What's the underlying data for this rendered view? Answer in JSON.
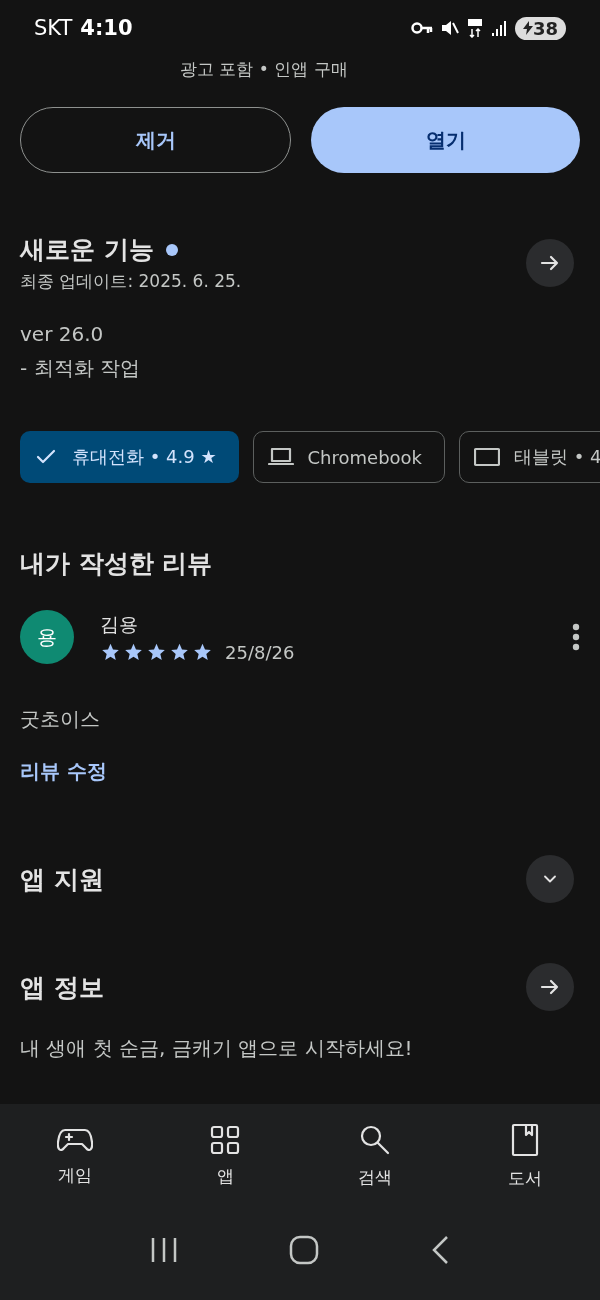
{
  "status_bar": {
    "carrier": "SKT",
    "time": "4:10",
    "battery": "38"
  },
  "app_meta": "광고 포함 • 인앱 구매",
  "actions": [
    {
      "label": "제거",
      "kind": "outline"
    },
    {
      "label": "열기",
      "kind": "filled"
    }
  ],
  "whats_new": {
    "title": "새로운 기능",
    "updated": "최종 업데이트: 2025. 6. 25.",
    "version": "ver 26.0",
    "notes": "- 최적화 작업"
  },
  "device_chips": [
    {
      "label": "휴대전화 • 4.9 ★",
      "kind": "phone",
      "selected": true
    },
    {
      "label": "Chromebook",
      "kind": "laptop",
      "selected": false
    },
    {
      "label": "태블릿 • 4",
      "kind": "tablet",
      "selected": false
    }
  ],
  "my_review": {
    "title": "내가 작성한 리뷰",
    "avatar": "용",
    "author": "김용",
    "stars": 5,
    "date": "25/8/26",
    "text": "굿초이스",
    "edit_link": "리뷰 수정"
  },
  "sections": [
    {
      "title": "앱 지원",
      "kind": "expand"
    },
    {
      "title": "앱 정보",
      "kind": "arrow"
    }
  ],
  "app_description": "내 생애 첫 순금, 금캐기 앱으로 시작하세요!",
  "bottom_nav": [
    {
      "label": "게임",
      "kind": "games"
    },
    {
      "label": "앱",
      "kind": "apps"
    },
    {
      "label": "검색",
      "kind": "search"
    },
    {
      "label": "도서",
      "kind": "books"
    }
  ]
}
